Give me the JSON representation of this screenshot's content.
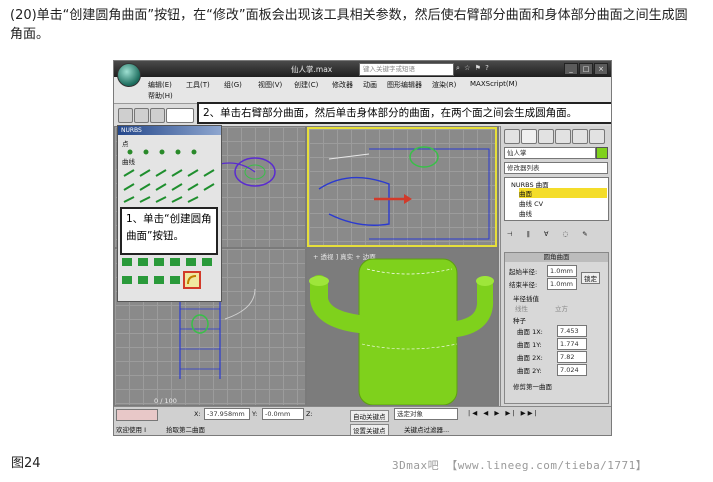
{
  "caption": "(20)单击“创建圆角曲面”按钮，在“修改”面板会出现该工具相关参数，然后使右臂部分曲面和身体部分曲面之间生成圆角面。",
  "figure_label": "图24",
  "bottom_watermark": "3Dmax吧 【www.lineeg.com/tieba/1771】",
  "app": {
    "title": "仙人掌.max",
    "search_placeholder": "键入关键字或短语",
    "menus": [
      "编辑(E)",
      "工具(T)",
      "组(G)",
      "视图(V)",
      "创建(C)",
      "修改器",
      "动画",
      "图形编辑器",
      "渲染(R)",
      "MAXScript(M)",
      "帮助(H)"
    ],
    "window_buttons": [
      "_",
      "□",
      "×"
    ]
  },
  "nurbs_toolbox": {
    "title": "NURBS",
    "sections": [
      "点",
      "曲线",
      "曲面"
    ]
  },
  "callouts": {
    "one": "1、单击“创建圆角曲面”按钮。",
    "two": "2、单击右臂部分曲面，然后单击身体部分的曲面，在两个面之间会生成圆角面。"
  },
  "viewports": {
    "perspective_label": "+ 透视 ] 真实 + 边面"
  },
  "panel": {
    "object_name": "仙人掌",
    "modifier_list": "修改器列表",
    "stack": [
      "NURBS 曲面",
      "曲面",
      "曲线 CV",
      "曲线"
    ],
    "rollout_title": "圆角曲面",
    "start_radius_label": "起始半径:",
    "start_radius_value": "1.0mm",
    "end_radius_label": "结束半径:",
    "end_radius_value": "1.0mm",
    "lock_label": "锁定",
    "radius_interp_label": "半径插值",
    "interp_options": [
      "线性",
      "立方"
    ],
    "seeds_label": "种子",
    "seeds": [
      {
        "label": "曲面 1X:",
        "value": "7.453"
      },
      {
        "label": "曲面 1Y:",
        "value": "1.774"
      },
      {
        "label": "曲面 2X:",
        "value": "7.82"
      },
      {
        "label": "曲面 2Y:",
        "value": "7.024"
      }
    ],
    "trim_label": "修剪第一曲面"
  },
  "status": {
    "frame_counter": "0 / 100",
    "x_label": "X:",
    "x_value": "-37.958mm",
    "y_label": "Y:",
    "y_value": "-0.0mm",
    "z_label": "Z:",
    "welcome": "欢迎使用 I",
    "prompt": "拾取第二曲面",
    "auto_key": "自动关键点",
    "selected_label": "选定对象",
    "set_key": "设置关键点",
    "key_filter": "关键点过滤器..."
  },
  "colors": {
    "cactus_green": "#7fd11c",
    "selection_yellow": "#e6df3a",
    "highlight_red": "#d23a2a",
    "nurbs_stack_selected": "#f4dd2a"
  }
}
